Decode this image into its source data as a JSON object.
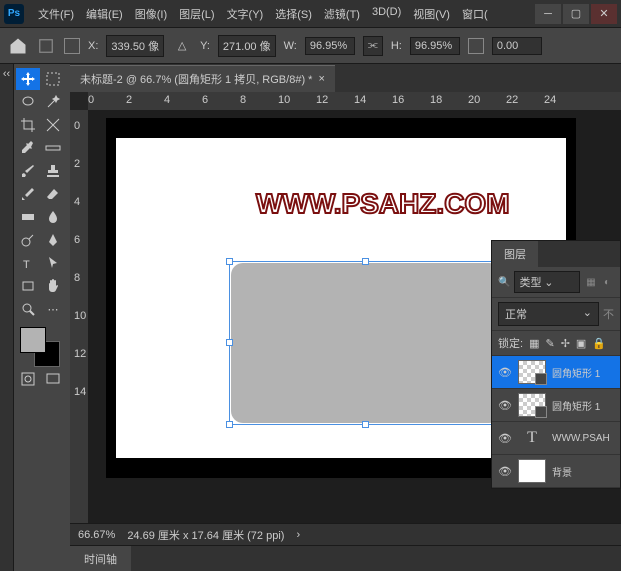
{
  "menu": [
    "文件(F)",
    "编辑(E)",
    "图像(I)",
    "图层(L)",
    "文字(Y)",
    "选择(S)",
    "滤镜(T)",
    "3D(D)",
    "视图(V)",
    "窗口("
  ],
  "options": {
    "x_label": "X:",
    "x_val": "339.50 像",
    "y_label": "Y:",
    "y_val": "271.00 像",
    "w_label": "W:",
    "w_val": "96.95%",
    "h_label": "H:",
    "h_val": "96.95%",
    "rot": "0.00"
  },
  "tab": {
    "title": "未标题-2 @ 66.7% (圆角矩形 1 拷贝, RGB/8#) *"
  },
  "ruler_h": [
    "0",
    "2",
    "4",
    "6",
    "8",
    "10",
    "12",
    "14",
    "16",
    "18",
    "20",
    "22",
    "24"
  ],
  "ruler_v": [
    "0",
    "2",
    "4",
    "6",
    "8",
    "10",
    "12",
    "14"
  ],
  "watermark": "WWW.PSAHZ.COM",
  "status": {
    "zoom": "66.67%",
    "dims": "24.69 厘米 x 17.64 厘米 (72 ppi)",
    "arrow": "›"
  },
  "bottom_tab": "时间轴",
  "panel": {
    "tab": "图层",
    "filter_placeholder": "类型",
    "blend": "正常",
    "lock_label": "锁定:",
    "layers": [
      {
        "name": "圆角矩形 1",
        "type": "shape"
      },
      {
        "name": "圆角矩形 1",
        "type": "shape"
      },
      {
        "name": "WWW.PSAH",
        "type": "text"
      },
      {
        "name": "背景",
        "type": "bg"
      }
    ]
  },
  "icons": {
    "search": "🔍",
    "link": "⫘",
    "triangle": "△",
    "eye": "👁",
    "chevron": "⌄",
    "ps": "Ps",
    "ellip": "不"
  }
}
